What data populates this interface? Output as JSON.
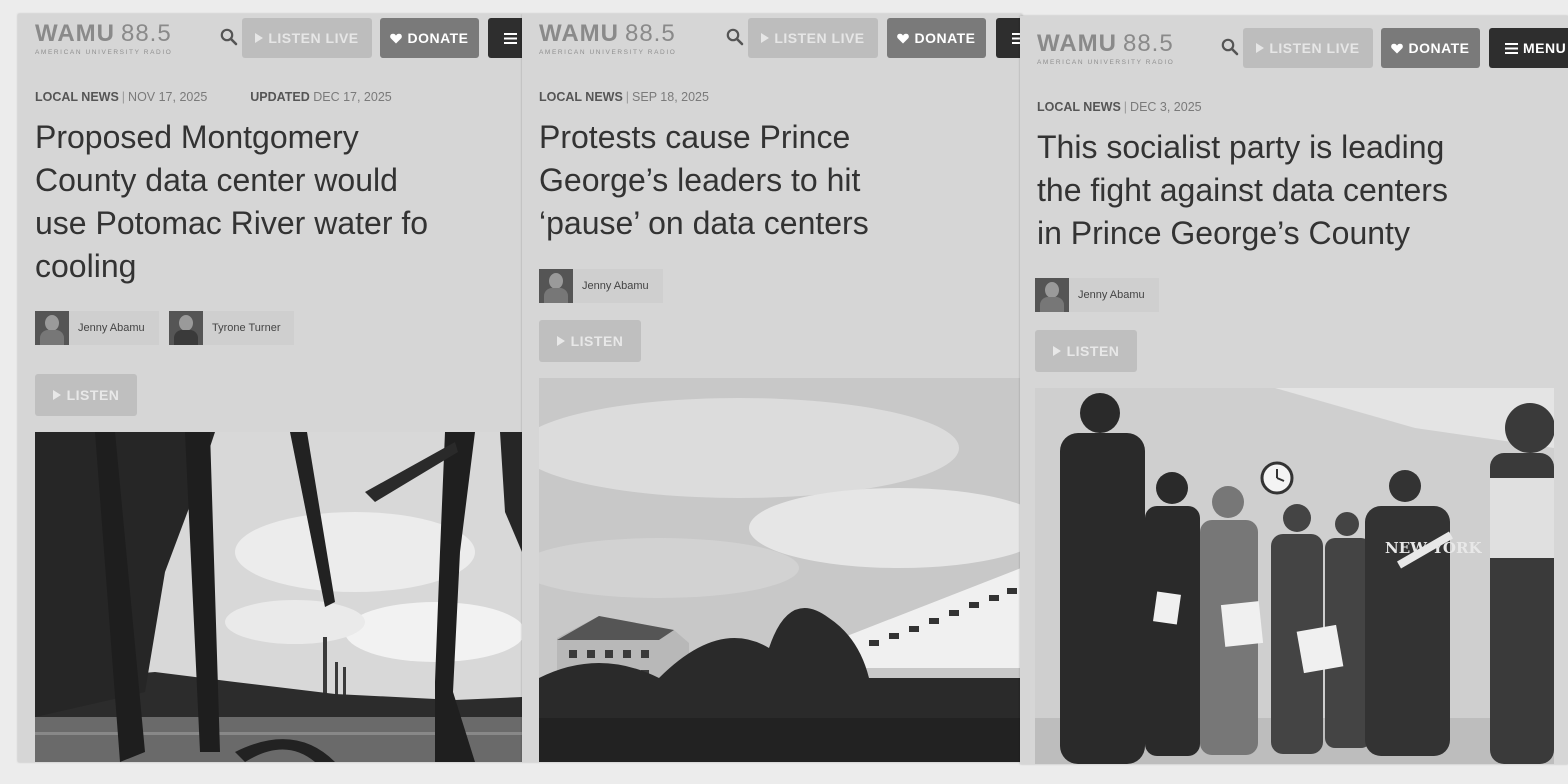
{
  "brand": {
    "call_letters": "WAMU",
    "frequency": "88.5",
    "tagline": "AMERICAN UNIVERSITY RADIO"
  },
  "nav": {
    "listen_live": "LISTEN LIVE",
    "donate": "DONATE",
    "menu": "MENU"
  },
  "listen_button": "LISTEN",
  "articles": [
    {
      "section": "LOCAL NEWS",
      "date": "NOV 17, 2025",
      "updated_label": "UPDATED",
      "updated_date": "DEC 17, 2025",
      "headline_lines": [
        "Proposed Montgomery",
        "County data center would",
        "use Potomac River water fo",
        "cooling"
      ],
      "authors": [
        "Jenny Abamu",
        "Tyrone Turner"
      ]
    },
    {
      "section": "LOCAL NEWS",
      "date": "SEP 18, 2025",
      "headline_lines": [
        "Protests cause Prince",
        "George’s leaders to hit",
        "‘pause’ on data centers"
      ],
      "authors": [
        "Jenny Abamu"
      ]
    },
    {
      "section": "LOCAL NEWS",
      "date": "DEC 3, 2025",
      "headline_lines": [
        "This socialist party is leading",
        "the fight against data centers",
        "in Prince George’s County"
      ],
      "authors": [
        "Jenny Abamu"
      ]
    }
  ],
  "colors": {
    "panel_bg": "#d6d6d6",
    "listen_live_bg": "#bdbdbd",
    "donate_bg": "#7a7a7a",
    "menu_bg": "#2e2e2e",
    "headline": "#333333"
  }
}
